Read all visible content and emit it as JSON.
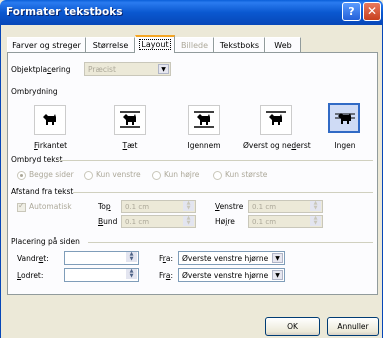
{
  "window": {
    "title": "Formater tekstboks",
    "help_glyph": "?",
    "close_glyph": "✕"
  },
  "tabs": [
    {
      "label": "Farver og streger",
      "state": "normal"
    },
    {
      "label": "Størrelse",
      "state": "normal"
    },
    {
      "label": "Layout",
      "state": "active"
    },
    {
      "label": "Billede",
      "state": "disabled"
    },
    {
      "label": "Tekstboks",
      "state": "normal"
    },
    {
      "label": "Web",
      "state": "normal"
    }
  ],
  "objektplacering": {
    "label_pre": "Objektpla",
    "label_u": "c",
    "label_post": "ering",
    "value": "Præcist"
  },
  "ombrydning": {
    "title": "Ombrydning",
    "options": [
      {
        "pre": "",
        "u": "F",
        "post": "irkantet"
      },
      {
        "pre": "",
        "u": "T",
        "post": "æt"
      },
      {
        "pre": "Igennem",
        "u": "",
        "post": ""
      },
      {
        "pre": "Øverst og ne",
        "u": "d",
        "post": "erst"
      },
      {
        "pre": "Ingen",
        "u": "",
        "post": ""
      }
    ],
    "selected_index": 4
  },
  "ombryd_tekst": {
    "title": "Ombryd tekst",
    "options": [
      "Begge sider",
      "Kun venstre",
      "Kun højre",
      "Kun største"
    ],
    "selected_index": 0
  },
  "afstand": {
    "title": "Afstand fra tekst",
    "automatisk": "Automatisk",
    "top_label": "Top",
    "top_value": "0.1 cm",
    "bund_label": "Bund",
    "bund_value": "0.1 cm",
    "venstre_label": "Venstre",
    "venstre_value": "0.1 cm",
    "hojre_label": "Højre",
    "hojre_value": "0.1 cm"
  },
  "placering": {
    "title": "Placering på siden",
    "vandret_label": "Vandret:",
    "vandret_value": "",
    "lodret_label": "Lodret:",
    "lodret_value": "",
    "fra_label": "Fra:",
    "fra_vandret_value": "Øverste venstre hjørne",
    "fra_lodret_value": "Øverste venstre hjørne"
  },
  "buttons": {
    "ok": "OK",
    "cancel": "Annuller"
  }
}
